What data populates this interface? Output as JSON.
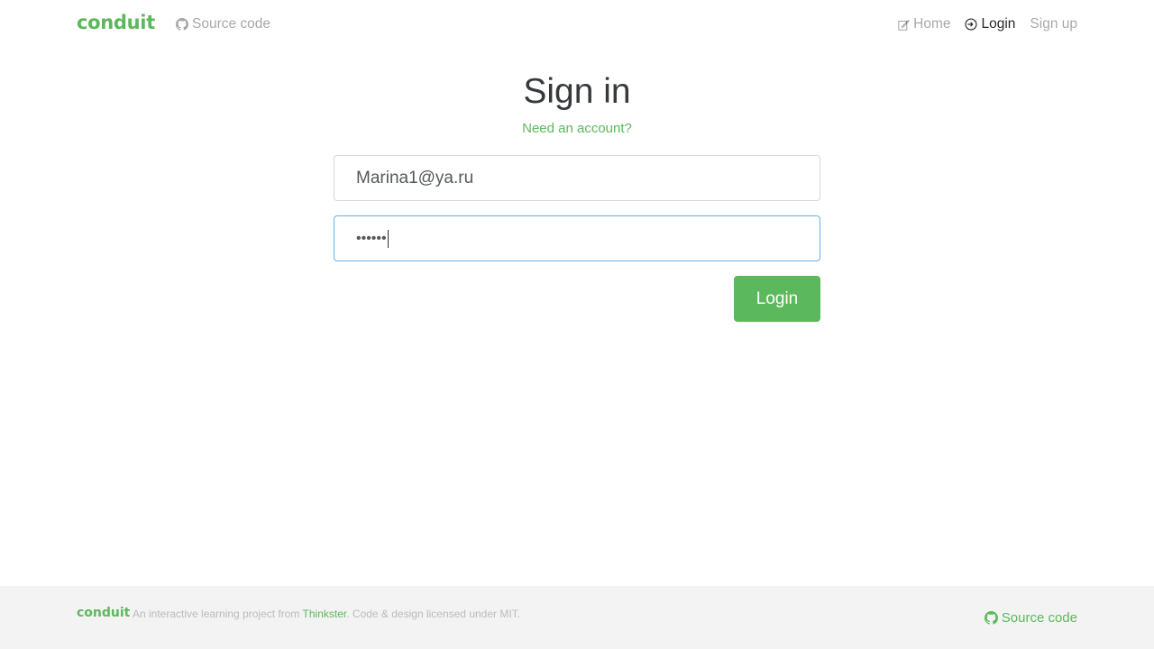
{
  "navbar": {
    "brand": "conduit",
    "source_code": "Source code",
    "links": {
      "home": "Home",
      "login": "Login",
      "signup": "Sign up"
    }
  },
  "auth": {
    "title": "Sign in",
    "need_account": "Need an account?",
    "email_value": "Marina1@ya.ru",
    "password_masked": "••••••",
    "login_button": "Login"
  },
  "footer": {
    "brand": "conduit",
    "attribution_prefix": "An interactive learning project from ",
    "attribution_link": "Thinkster",
    "attribution_suffix": ". Code & design licensed under MIT.",
    "source_code": "Source code"
  },
  "colors": {
    "brand": "#5cb85c",
    "focus_border": "#66afe9",
    "footer_bg": "#f3f3f3"
  },
  "icons": {
    "github": "github-icon",
    "home": "edit-icon",
    "login": "login-icon"
  }
}
